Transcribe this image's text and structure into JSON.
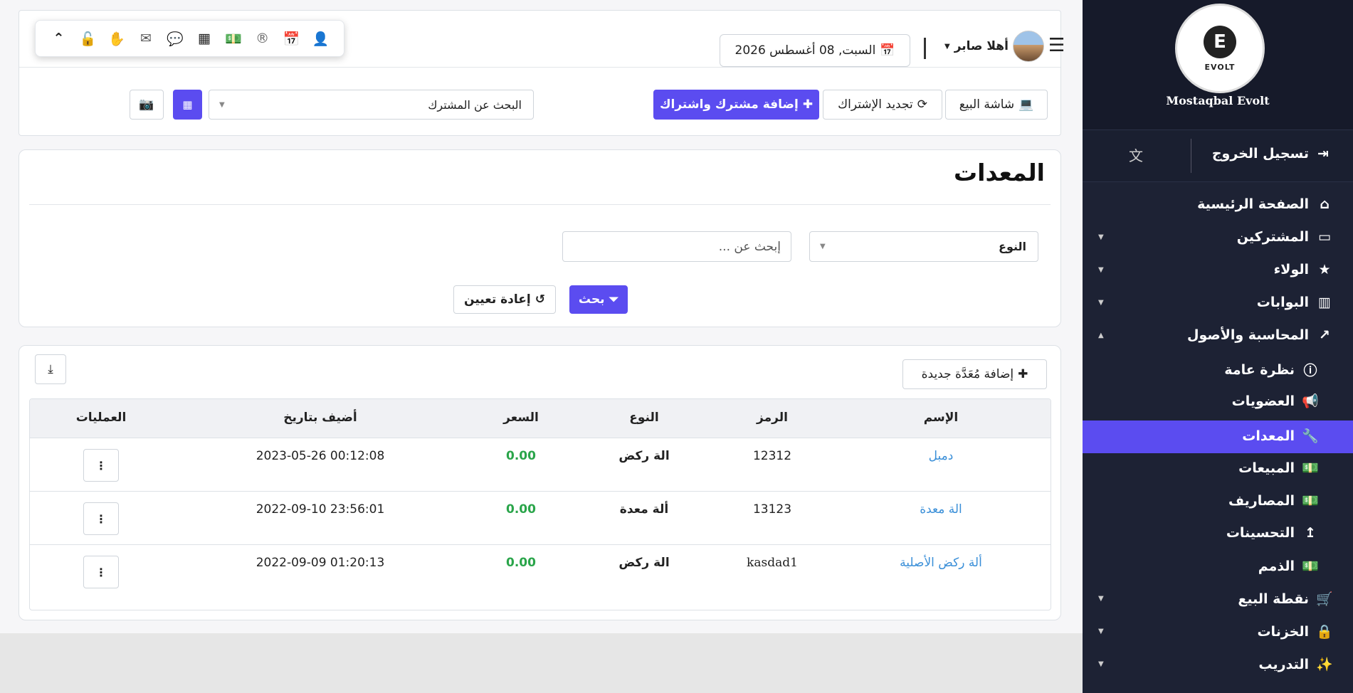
{
  "topbar": {
    "user_greeting": "أهلا صابر",
    "date": "السبت, 08 أغسطس 2026",
    "pos_screen": "شاشة البيع",
    "renew_subscription": "تجديد الإشتراك",
    "add_subscriber": "إضافة مشترك واشتراك",
    "search_subscriber": "البحث عن المشترك"
  },
  "icons": [
    "chevron-up-icon",
    "unlock-icon",
    "hand-icon",
    "envelope-icon",
    "comment-icon",
    "qrcode-icon",
    "money-icon",
    "registered-icon",
    "calendar-icon",
    "user-plus-icon"
  ],
  "page": {
    "title": "المعدات",
    "type_select": "النوع",
    "search_placeholder": "إبحث عن ...",
    "search_button": "بحث",
    "reset_button": "إعادة تعيين",
    "add_equipment": "إضافة مُعَدَّة جديدة"
  },
  "table": {
    "headers": {
      "name": "الإسم",
      "code": "الرمز",
      "type": "النوع",
      "price": "السعر",
      "added": "أضيف بتاريخ",
      "actions": "العمليات"
    },
    "rows": [
      {
        "name": "دمبل",
        "code": "12312",
        "type": "الة ركض",
        "price": "0.00",
        "added": "2023-05-26 00:12:08"
      },
      {
        "name": "الة معدة",
        "code": "13123",
        "type": "ألة معدة",
        "price": "0.00",
        "added": "2022-09-10 23:56:01"
      },
      {
        "name": "ألة ركض الأصلية",
        "code": "kasdad1",
        "type": "الة ركض",
        "price": "0.00",
        "added": "2022-09-09 01:20:13"
      }
    ]
  },
  "sidebar": {
    "brand": "Mostaqbal Evolt",
    "logo_text": "EVOLT",
    "logout": "تسجيل الخروج",
    "items": [
      {
        "label": "الصفحة الرئيسية",
        "icon": "home-icon"
      },
      {
        "label": "المشتركين",
        "icon": "laptop-icon"
      },
      {
        "label": "الولاء",
        "icon": "star-icon"
      },
      {
        "label": "البوابات",
        "icon": "building-icon"
      },
      {
        "label": "المحاسبة والأصول",
        "icon": "chart-icon"
      },
      {
        "label": "نظرة عامة",
        "icon": "info-icon"
      },
      {
        "label": "العضويات",
        "icon": "bullhorn-icon"
      },
      {
        "label": "المعدات",
        "icon": "wrench-icon"
      },
      {
        "label": "المبيعات",
        "icon": "money-icon"
      },
      {
        "label": "المصاريف",
        "icon": "money-icon"
      },
      {
        "label": "التحسينات",
        "icon": "level-up-icon"
      },
      {
        "label": "الذمم",
        "icon": "money-icon"
      },
      {
        "label": "نقطة البيع",
        "icon": "cart-icon"
      },
      {
        "label": "الخزنات",
        "icon": "lock-icon"
      },
      {
        "label": "التدريب",
        "icon": "magic-icon"
      }
    ]
  }
}
